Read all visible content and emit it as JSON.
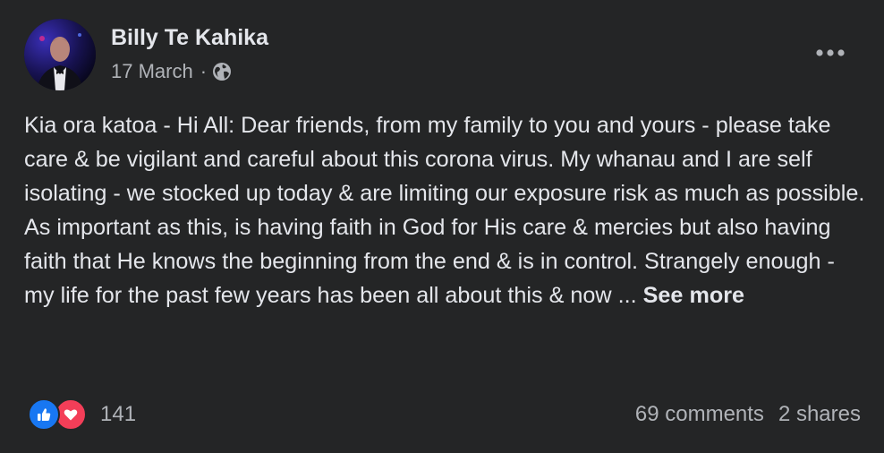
{
  "post": {
    "author": "Billy Te Kahika",
    "date": "17 March",
    "separator": "·",
    "privacy_icon": "globe-icon",
    "menu_icon": "more-options-icon",
    "body_text": "Kia ora katoa - Hi All: Dear friends, from my family to you and yours - please take care & be vigilant and careful about this corona virus. My whanau and I are self isolating - we stocked up today & are limiting our exposure risk as much as possible. As important as this, is having faith in God for His care & mercies but also having faith that He knows the beginning from the end & is in control. Strangely enough - my life for the past few years has been all about this & now ... ",
    "see_more": "See more"
  },
  "engagement": {
    "reaction_icons": [
      "like-icon",
      "love-icon"
    ],
    "reaction_count": "141",
    "comments": "69 comments",
    "shares": "2 shares"
  },
  "colors": {
    "background": "#242526",
    "primary_text": "#e4e6eb",
    "secondary_text": "#b0b3b8",
    "like_blue": "#1877f2",
    "love_red": "#f33e58"
  }
}
